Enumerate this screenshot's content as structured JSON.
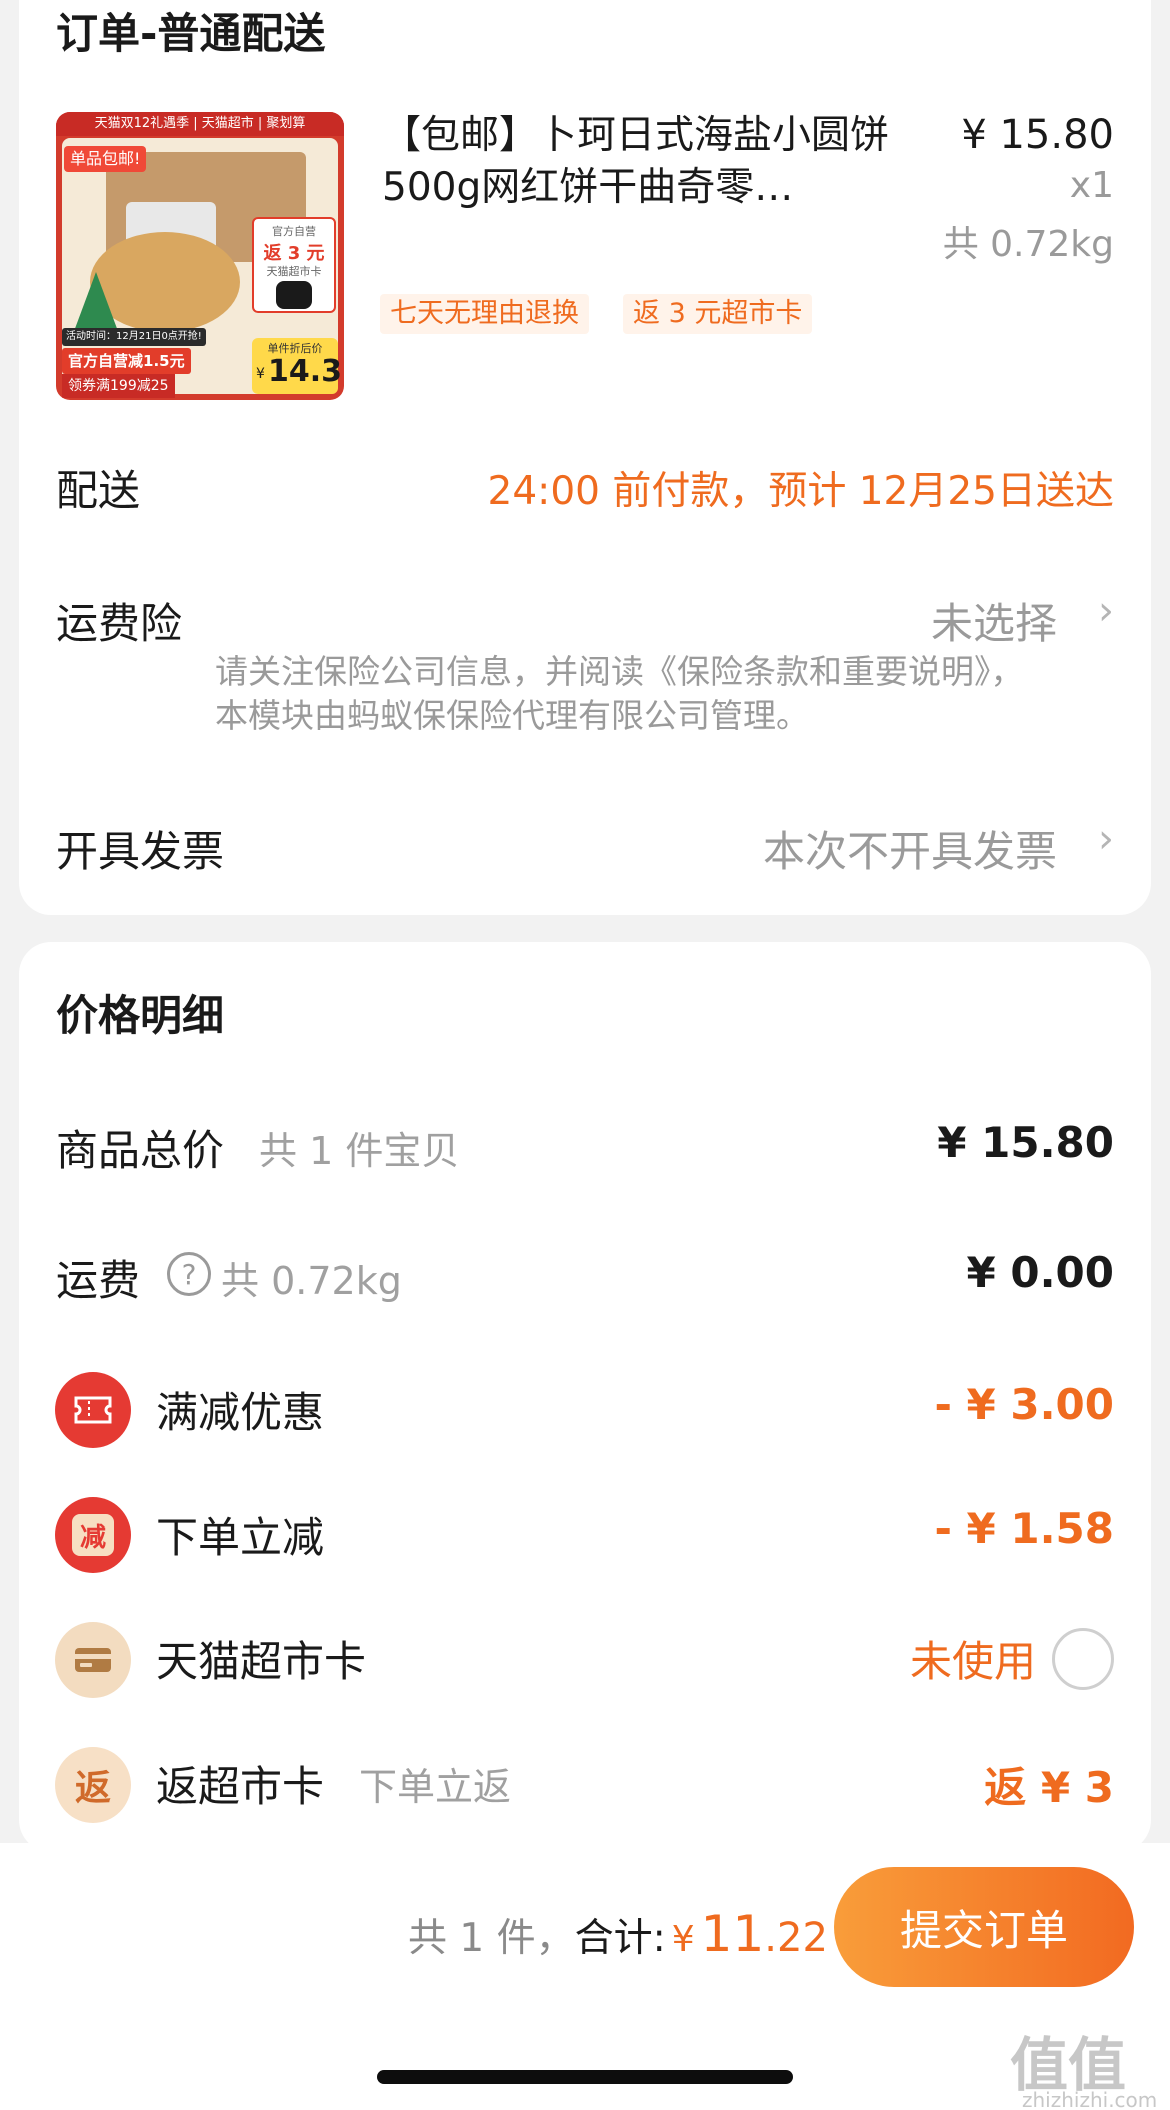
{
  "order_section": {
    "title": "订单-普通配送",
    "product": {
      "image_badges": {
        "top_banner": "天猫双12礼遇季 | 天猫超市 | 聚划算",
        "free_shipping": "单品包邮!",
        "activity_time": "活动时间：12月21日0点开抢!",
        "self_discount": "官方自营减1.5元",
        "coupon": "领券满199减25",
        "card_return_top": "官方自营",
        "card_return_main": "返 3 元",
        "card_return_sub": "天猫超市卡",
        "unit_price_label": "单件折后价",
        "unit_price_symbol": "¥",
        "unit_price": "14.3"
      },
      "name": "【包邮】卜珂日式海盐小圆饼500g网红饼干曲奇零…",
      "price": "¥ 15.80",
      "quantity": "x1",
      "weight": "共 0.72kg",
      "tags": [
        "七天无理由退换",
        "返 3 元超市卡"
      ]
    },
    "delivery": {
      "label": "配送",
      "value": "24:00 前付款，预计 12月25日送达"
    },
    "shipping_insurance": {
      "label": "运费险",
      "value": "未选择",
      "note": "请关注保险公司信息，并阅读《保险条款和重要说明》，本模块由蚂蚁保保险代理有限公司管理。"
    },
    "invoice": {
      "label": "开具发票",
      "value": "本次不开具发票"
    }
  },
  "price_details": {
    "title": "价格明细",
    "goods_total": {
      "label": "商品总价",
      "sub": "共 1 件宝贝",
      "value": "¥ 15.80"
    },
    "shipping": {
      "label": "运费",
      "sub": "共 0.72kg",
      "value": "¥ 0.00",
      "help_glyph": "?"
    },
    "full_reduction": {
      "label": "满减优惠",
      "value": "- ¥ 3.00"
    },
    "order_reduction": {
      "label": "下单立减",
      "value": "- ¥ 1.58",
      "icon_char": "减"
    },
    "tmall_card": {
      "label": "天猫超市卡",
      "value": "未使用"
    },
    "return_card": {
      "label": "返超市卡",
      "sub": "下单立返",
      "value": "返 ¥ 3",
      "icon_char": "返"
    }
  },
  "bottom_bar": {
    "count_text": "共 1 件，",
    "total_label": "合计:",
    "currency": "¥",
    "total_int": "11",
    "total_dec": ".22",
    "submit_label": "提交订单"
  },
  "watermark": {
    "text": "值值值",
    "url": "zhizhizhi.com"
  },
  "colors": {
    "accent": "#ef6b1f",
    "red_icon": "#e53a33",
    "gold_icon": "#f7dfc2",
    "background": "#f2f2f2"
  }
}
